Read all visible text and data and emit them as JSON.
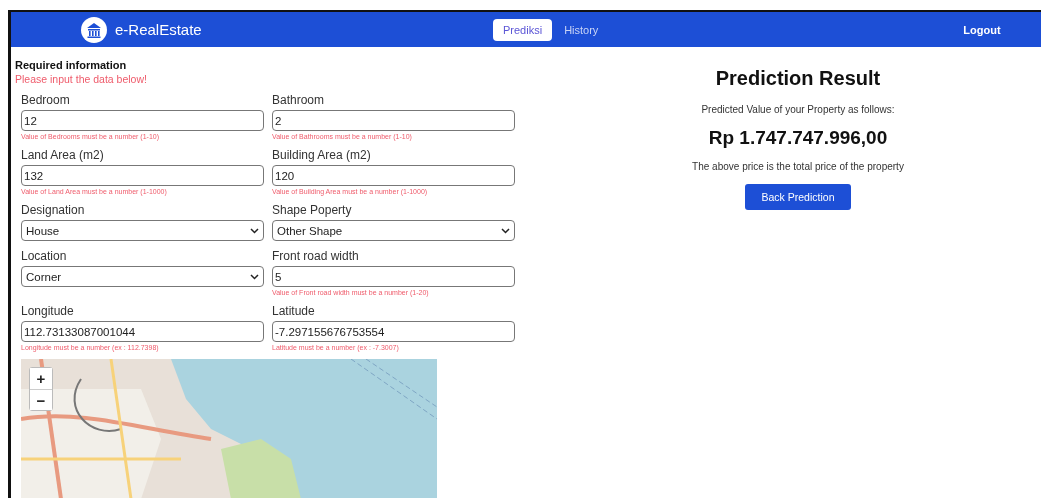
{
  "navbar": {
    "brand": "e-RealEstate",
    "tabs": [
      {
        "label": "Prediksi",
        "selected": true
      },
      {
        "label": "History",
        "selected": false
      }
    ],
    "logout": "Logout"
  },
  "form": {
    "title": "Required information",
    "subtitle": "Please input the data below!",
    "fields": [
      {
        "kind": "text",
        "label": "Bedroom",
        "value": "12",
        "hint": "Value of Bedrooms must be a number (1-10)"
      },
      {
        "kind": "text",
        "label": "Bathroom",
        "value": "2",
        "hint": "Value of Bathrooms must be a number (1-10)"
      },
      {
        "kind": "text",
        "label": "Land Area (m2)",
        "value": "132",
        "hint": "Value of Land Area must be a number (1-1000)"
      },
      {
        "kind": "text",
        "label": "Building Area (m2)",
        "value": "120",
        "hint": "Value of Building Area must be a number (1-1000)"
      },
      {
        "kind": "select",
        "label": "Designation",
        "value": "House"
      },
      {
        "kind": "select",
        "label": "Shape Poperty",
        "value": "Other Shape"
      },
      {
        "kind": "select",
        "label": "Location",
        "value": "Corner"
      },
      {
        "kind": "text",
        "label": "Front road width",
        "value": "5",
        "hint": "Value of Front road width must be a number (1-20)"
      },
      {
        "kind": "text",
        "label": "Longitude",
        "value": "112.73133087001044",
        "hint": "Longitude must be a number (ex : 112.7398)"
      },
      {
        "kind": "text",
        "label": "Latitude",
        "value": "-7.297155676753554",
        "hint": "Latitude must be a number (ex : -7.3007)"
      }
    ],
    "map": {
      "kind": "picture",
      "zoom_in": "+",
      "zoom_out": "−"
    }
  },
  "result": {
    "title": "Prediction Result",
    "intro": "Predicted Value of your Property as follows:",
    "price": "Rp 1.747.747.996,00",
    "note": "The above price is the total price of the property",
    "button": "Back Prediction"
  }
}
